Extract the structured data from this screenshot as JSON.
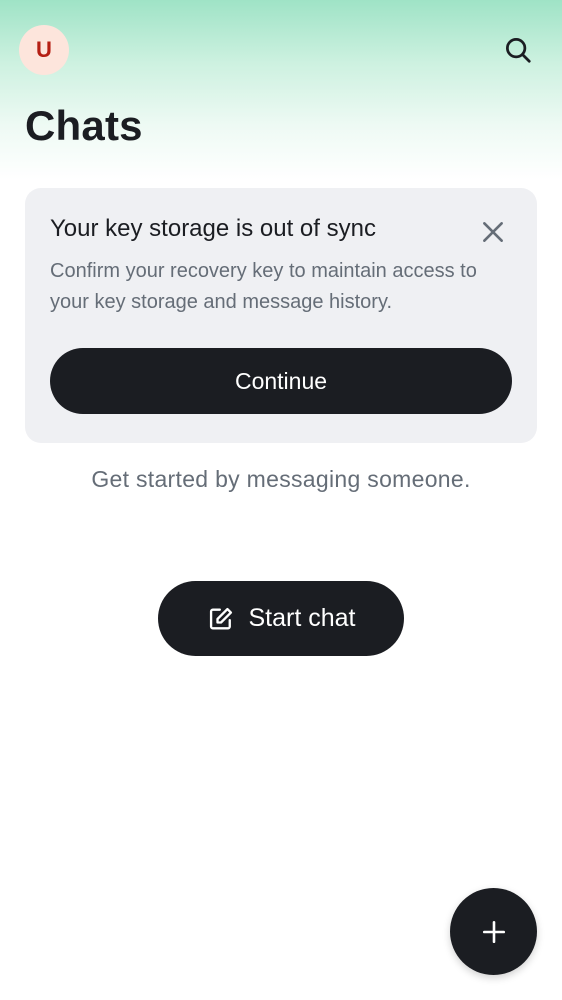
{
  "header": {
    "avatar_initial": "U",
    "title": "Chats",
    "search_icon": "search-icon"
  },
  "banner": {
    "title": "Your key storage is out of sync",
    "body": "Confirm your recovery key to maintain access to your key storage and message history.",
    "continue_label": "Continue",
    "close_icon": "close-icon"
  },
  "empty_state": {
    "message": "Get started by messaging someone.",
    "start_chat_label": "Start chat",
    "start_chat_icon": "compose-icon"
  },
  "fab": {
    "icon": "plus-icon"
  },
  "colors": {
    "accent_dark": "#1b1d22",
    "avatar_bg": "#fde5dc",
    "avatar_text": "#b51f14",
    "banner_bg": "#eff0f3",
    "secondary_text": "#656d77",
    "header_gradient": "#9fe3c6"
  }
}
